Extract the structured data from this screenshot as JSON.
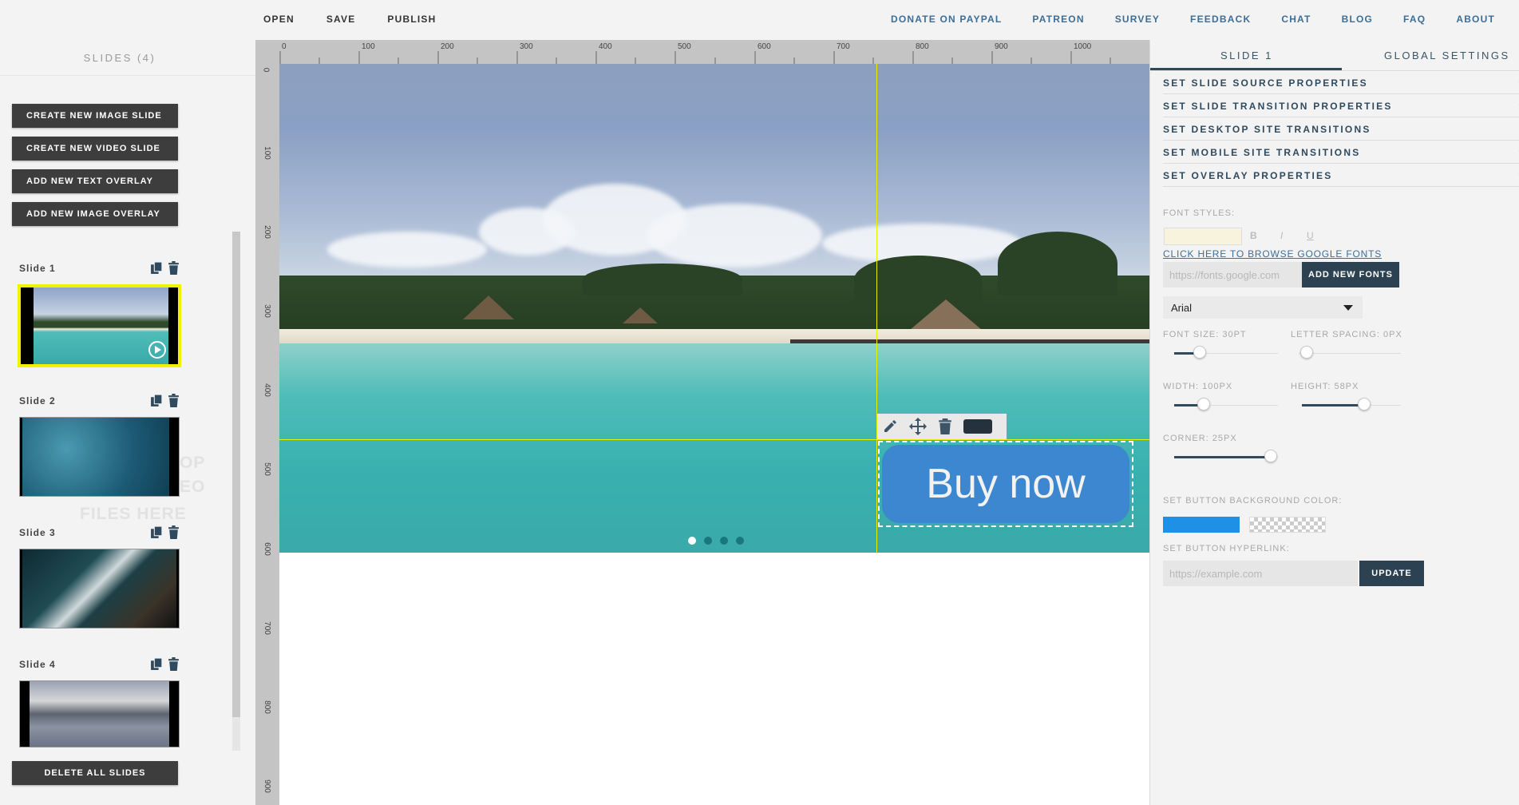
{
  "topbar": {
    "left": [
      "OPEN",
      "SAVE",
      "PUBLISH"
    ],
    "right": [
      "DONATE ON PAYPAL",
      "PATREON",
      "SURVEY",
      "FEEDBACK",
      "CHAT",
      "BLOG",
      "FAQ",
      "ABOUT"
    ]
  },
  "sidebar": {
    "title": "SLIDES (4)",
    "buttons": [
      "CREATE NEW IMAGE SLIDE",
      "CREATE NEW VIDEO SLIDE",
      "ADD NEW TEXT OVERLAY",
      "ADD NEW IMAGE OVERLAY"
    ],
    "slides": [
      "Slide 1",
      "Slide 2",
      "Slide 3",
      "Slide 4"
    ],
    "drop_text": [
      "OP",
      "EO",
      "FILES HERE"
    ],
    "delete_all": "DELETE ALL SLIDES"
  },
  "ruler": {
    "top": [
      "0",
      "100",
      "200",
      "300",
      "400",
      "500",
      "600",
      "700",
      "800",
      "900",
      "1000"
    ],
    "left": [
      "0",
      "100",
      "200",
      "300",
      "400",
      "500",
      "600",
      "700",
      "800",
      "900"
    ]
  },
  "canvas": {
    "overlay_text": "Buy now",
    "dots_active": 0,
    "dots_count": 4
  },
  "panel": {
    "tab_active": "SLIDE 1",
    "tab_other": "GLOBAL SETTINGS",
    "sections": [
      "SET SLIDE SOURCE PROPERTIES",
      "SET SLIDE TRANSITION PROPERTIES",
      "SET DESKTOP SITE TRANSITIONS",
      "SET MOBILE SITE TRANSITIONS",
      "SET OVERLAY PROPERTIES"
    ],
    "font_styles_label": "FONT STYLES:",
    "bold": "B",
    "italic": "I",
    "underline": "U",
    "google_fonts_link": "CLICK HERE TO BROWSE GOOGLE FONTS",
    "fonts_placeholder": "https://fonts.google.com",
    "add_fonts": "ADD NEW FONTS",
    "font_select": "Arial",
    "font_size": "FONT SIZE: 30PT",
    "letter_spacing": "LETTER SPACING: 0PX",
    "width": "WIDTH: 100PX",
    "height": "HEIGHT: 58PX",
    "corner": "CORNER: 25PX",
    "bg_color_label": "SET BUTTON BACKGROUND COLOR:",
    "hyperlink_label": "SET BUTTON HYPERLINK:",
    "hyperlink_placeholder": "https://example.com",
    "update": "UPDATE",
    "button_bg_color": "#1e90e6"
  }
}
